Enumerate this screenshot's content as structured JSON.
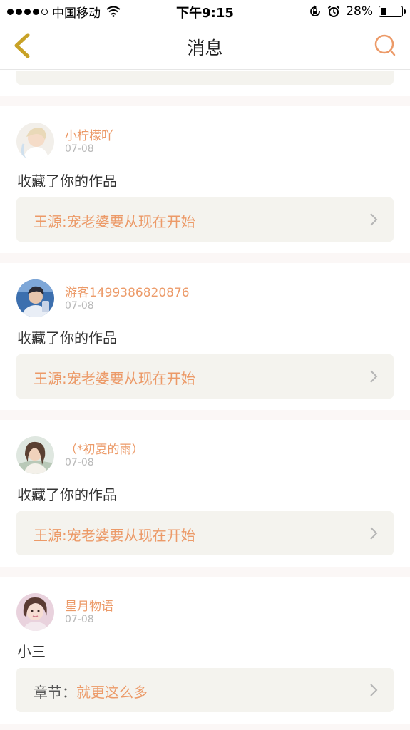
{
  "status_bar": {
    "carrier": "中国移动",
    "time": "下午9:15",
    "battery_percent": "28%",
    "battery_level": 0.28,
    "signal_bars_filled": 4,
    "signal_bars_total": 5
  },
  "nav": {
    "title": "消息",
    "back_icon": "chevron-left-icon",
    "search_icon": "search-icon",
    "accent_color": "#ec9a68",
    "back_color": "#c8a227"
  },
  "messages": [
    {
      "username": "小柠檬吖",
      "date": "07-08",
      "action": "收藏了你的作品",
      "ref_label": "",
      "ref_title": "王源:宠老婆要从现在开始"
    },
    {
      "username": "游客1499386820876",
      "date": "07-08",
      "action": "收藏了你的作品",
      "ref_label": "",
      "ref_title": "王源:宠老婆要从现在开始"
    },
    {
      "username": "（*初夏的雨）",
      "date": "07-08",
      "action": "收藏了你的作品",
      "ref_label": "",
      "ref_title": "王源:宠老婆要从现在开始"
    },
    {
      "username": "星月物语",
      "date": "07-08",
      "action": "小三",
      "ref_label": "章节：",
      "ref_title": "就更这么多"
    }
  ]
}
